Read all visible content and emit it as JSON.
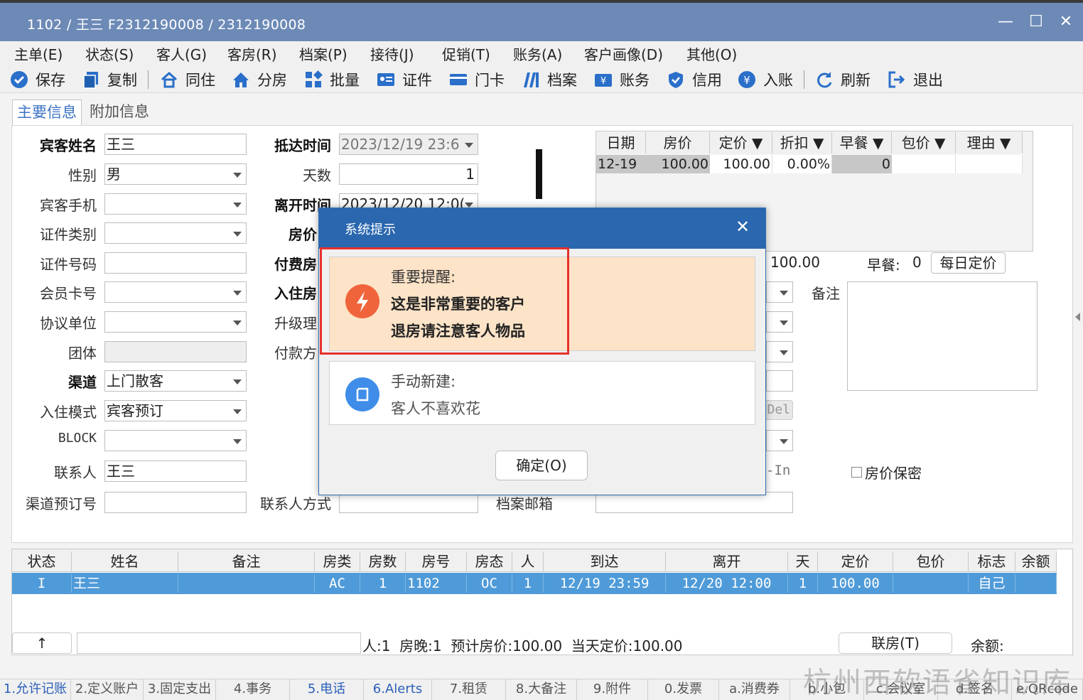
{
  "window": {
    "title": "1102 / 王三 F2312190008 / 2312190008",
    "minimize": "—",
    "maximize": "☐",
    "close": "✕"
  },
  "menu": [
    "主单(E)",
    "状态(S)",
    "客人(G)",
    "客房(R)",
    "档案(P)",
    "接待(J)",
    "促销(T)",
    "账务(A)",
    "客户画像(D)",
    "其他(O)"
  ],
  "toolbar": {
    "save": "保存",
    "copy": "复制",
    "cohabit": "同住",
    "assign": "分房",
    "batch": "批量",
    "id": "证件",
    "card": "门卡",
    "profile": "档案",
    "account": "账务",
    "credit": "信用",
    "post": "入账",
    "refresh": "刷新",
    "exit": "退出"
  },
  "tabs": {
    "main": "主要信息",
    "extra": "附加信息"
  },
  "form": {
    "guest_name": {
      "label": "宾客姓名",
      "value": "王三"
    },
    "gender": {
      "label": "性别",
      "value": "男"
    },
    "mobile": {
      "label": "宾客手机",
      "value": ""
    },
    "id_type": {
      "label": "证件类别",
      "value": ""
    },
    "id_no": {
      "label": "证件号码",
      "value": ""
    },
    "member_card": {
      "label": "会员卡号",
      "value": ""
    },
    "agreement": {
      "label": "协议单位",
      "value": ""
    },
    "group": {
      "label": "团体",
      "value": ""
    },
    "channel": {
      "label": "渠道",
      "value": "上门散客"
    },
    "checkin_mode": {
      "label": "入住模式",
      "value": "宾客预订"
    },
    "block": {
      "label": "BLOCK",
      "value": ""
    },
    "contact": {
      "label": "联系人",
      "value": "王三"
    },
    "channel_order": {
      "label": "渠道预订号",
      "value": ""
    },
    "arrival": {
      "label": "抵达时间",
      "value": "2023/12/19 23:6"
    },
    "days": {
      "label": "天数",
      "value": "1"
    },
    "departure": {
      "label": "离开时间",
      "value": "2023/12/20 12:0("
    },
    "room_price": {
      "label": "房价",
      "value": ""
    },
    "pay_room": {
      "label": "付费房",
      "value": ""
    },
    "checkin_room": {
      "label": "入住房",
      "value": ""
    },
    "upgrade": {
      "label": "升级理",
      "value": ""
    },
    "pay_method": {
      "label": "付款方",
      "value": ""
    },
    "contact_method": {
      "label": "联系人方式",
      "value": ""
    },
    "profile_email": {
      "label": "档案邮箱",
      "value": ""
    },
    "amount": "100.00",
    "breakfast_label": "早餐:",
    "breakfast_value": "0",
    "daily_price_btn": "每日定价",
    "remark": {
      "label": "备注",
      "value": ""
    },
    "del_btn": "Del",
    "in_text": "-In",
    "price_secret": "房价保密"
  },
  "price_grid": {
    "headers": [
      "日期",
      "房价",
      "定价 ▼",
      "折扣 ▼",
      "早餐 ▼",
      "包价 ▼",
      "理由 ▼"
    ],
    "row": [
      "12-19",
      "100.00",
      "100.00",
      "0.00%",
      "0",
      "",
      ""
    ]
  },
  "guest_table": {
    "headers": [
      "状态",
      "姓名",
      "备注",
      "房类",
      "房数",
      "房号",
      "房态",
      "人",
      "到达",
      "离开",
      "天",
      "定价",
      "包价",
      "标志",
      "余额"
    ],
    "rows": [
      [
        "I",
        "王三",
        "",
        "AC",
        "1",
        "1102",
        "OC",
        "1",
        "12/19 23:59",
        "12/20 12:00",
        "1",
        "100.00",
        "",
        "自己",
        ""
      ]
    ]
  },
  "summary": {
    "up_arrow": "↑",
    "text": "人:1  房晚:1  预计房价:100.00  当天定价:100.00",
    "link_btn": "联房(T)",
    "balance": "余额:"
  },
  "status_tabs": [
    "1.允许记账",
    "2.定义账户",
    "3.固定支出",
    "4.事务",
    "5.电话",
    "6.Alerts",
    "7.租赁",
    "8.大备注",
    "9.附件",
    "0.发票",
    "a.消费券",
    "b.小包",
    "c.会议室",
    "d.签名",
    "e.QRcode"
  ],
  "watermark": "杭州西软语雀知识库",
  "dialog": {
    "title": "系统提示",
    "close": "✕",
    "card1": {
      "title": "重要提醒:",
      "line1": "这是非常重要的客户",
      "line2": "退房请注意客人物品"
    },
    "card2": {
      "title": "手动新建:",
      "line1": "客人不喜欢花"
    },
    "ok": "确定(O)"
  },
  "colors": {
    "titlebar": "#6d8ab7",
    "dialog_header": "#2a67ae",
    "selected_row": "#4f9bd9",
    "alert_card": "#fde3c7",
    "alert_icon": "#f0643c",
    "info_icon": "#3f8de8",
    "highlight": "#e5322c"
  }
}
